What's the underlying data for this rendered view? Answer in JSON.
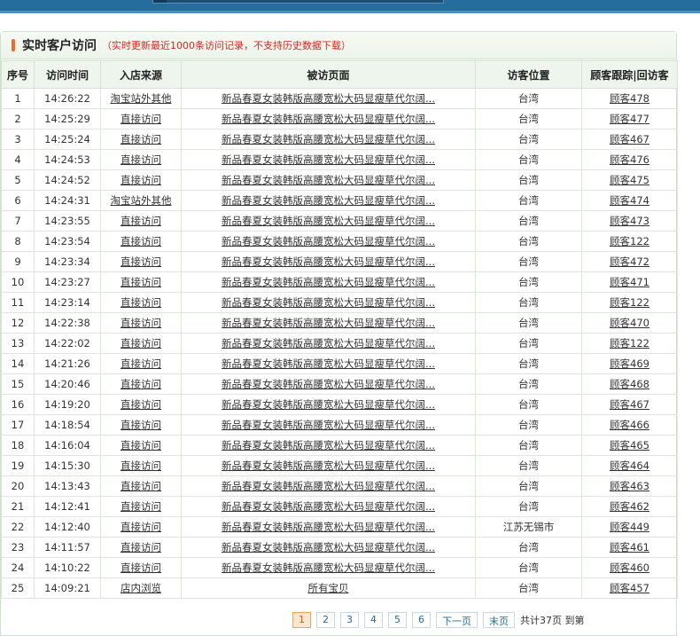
{
  "title": "实时客户访问",
  "note": "（实时更新最近1000条访问记录，不支持历史数据下载）",
  "columns": [
    "序号",
    "访问时间",
    "入店来源",
    "被访页面",
    "访客位置",
    "顾客跟踪|回访客"
  ],
  "rows": [
    [
      "1",
      "14:26:22",
      "淘宝站外其他",
      "新品春夏女装韩版高腰宽松大码显瘦草代尔阔...",
      "台湾",
      "顾客478"
    ],
    [
      "2",
      "14:25:29",
      "直接访问",
      "新品春夏女装韩版高腰宽松大码显瘦草代尔阔...",
      "台湾",
      "顾客477"
    ],
    [
      "3",
      "14:25:24",
      "直接访问",
      "新品春夏女装韩版高腰宽松大码显瘦草代尔阔...",
      "台湾",
      "顾客467"
    ],
    [
      "4",
      "14:24:53",
      "直接访问",
      "新品春夏女装韩版高腰宽松大码显瘦草代尔阔...",
      "台湾",
      "顾客476"
    ],
    [
      "5",
      "14:24:52",
      "直接访问",
      "新品春夏女装韩版高腰宽松大码显瘦草代尔阔...",
      "台湾",
      "顾客475"
    ],
    [
      "6",
      "14:24:31",
      "淘宝站外其他",
      "新品春夏女装韩版高腰宽松大码显瘦草代尔阔...",
      "台湾",
      "顾客474"
    ],
    [
      "7",
      "14:23:55",
      "直接访问",
      "新品春夏女装韩版高腰宽松大码显瘦草代尔阔...",
      "台湾",
      "顾客473"
    ],
    [
      "8",
      "14:23:54",
      "直接访问",
      "新品春夏女装韩版高腰宽松大码显瘦草代尔阔...",
      "台湾",
      "顾客122"
    ],
    [
      "9",
      "14:23:34",
      "直接访问",
      "新品春夏女装韩版高腰宽松大码显瘦草代尔阔...",
      "台湾",
      "顾客472"
    ],
    [
      "10",
      "14:23:27",
      "直接访问",
      "新品春夏女装韩版高腰宽松大码显瘦草代尔阔...",
      "台湾",
      "顾客471"
    ],
    [
      "11",
      "14:23:14",
      "直接访问",
      "新品春夏女装韩版高腰宽松大码显瘦草代尔阔...",
      "台湾",
      "顾客122"
    ],
    [
      "12",
      "14:22:38",
      "直接访问",
      "新品春夏女装韩版高腰宽松大码显瘦草代尔阔...",
      "台湾",
      "顾客470"
    ],
    [
      "13",
      "14:22:02",
      "直接访问",
      "新品春夏女装韩版高腰宽松大码显瘦草代尔阔...",
      "台湾",
      "顾客122"
    ],
    [
      "14",
      "14:21:26",
      "直接访问",
      "新品春夏女装韩版高腰宽松大码显瘦草代尔阔...",
      "台湾",
      "顾客469"
    ],
    [
      "15",
      "14:20:46",
      "直接访问",
      "新品春夏女装韩版高腰宽松大码显瘦草代尔阔...",
      "台湾",
      "顾客468"
    ],
    [
      "16",
      "14:19:20",
      "直接访问",
      "新品春夏女装韩版高腰宽松大码显瘦草代尔阔...",
      "台湾",
      "顾客467"
    ],
    [
      "17",
      "14:18:54",
      "直接访问",
      "新品春夏女装韩版高腰宽松大码显瘦草代尔阔...",
      "台湾",
      "顾客466"
    ],
    [
      "18",
      "14:16:04",
      "直接访问",
      "新品春夏女装韩版高腰宽松大码显瘦草代尔阔...",
      "台湾",
      "顾客465"
    ],
    [
      "19",
      "14:15:30",
      "直接访问",
      "新品春夏女装韩版高腰宽松大码显瘦草代尔阔...",
      "台湾",
      "顾客464"
    ],
    [
      "20",
      "14:13:43",
      "直接访问",
      "新品春夏女装韩版高腰宽松大码显瘦草代尔阔...",
      "台湾",
      "顾客463"
    ],
    [
      "21",
      "14:12:41",
      "直接访问",
      "新品春夏女装韩版高腰宽松大码显瘦草代尔阔...",
      "台湾",
      "顾客462"
    ],
    [
      "22",
      "14:12:40",
      "直接访问",
      "新品春夏女装韩版高腰宽松大码显瘦草代尔阔...",
      "江苏无锡市",
      "顾客449"
    ],
    [
      "23",
      "14:11:57",
      "直接访问",
      "新品春夏女装韩版高腰宽松大码显瘦草代尔阔...",
      "台湾",
      "顾客461"
    ],
    [
      "24",
      "14:10:22",
      "直接访问",
      "新品春夏女装韩版高腰宽松大码显瘦草代尔阔...",
      "台湾",
      "顾客460"
    ],
    [
      "25",
      "14:09:21",
      "店内浏览",
      "所有宝贝",
      "台湾",
      "顾客457"
    ]
  ],
  "pager": {
    "pages": [
      "1",
      "2",
      "3",
      "4",
      "5",
      "6"
    ],
    "next": "下一页",
    "last": "末页",
    "total": "共计37页 到第"
  }
}
